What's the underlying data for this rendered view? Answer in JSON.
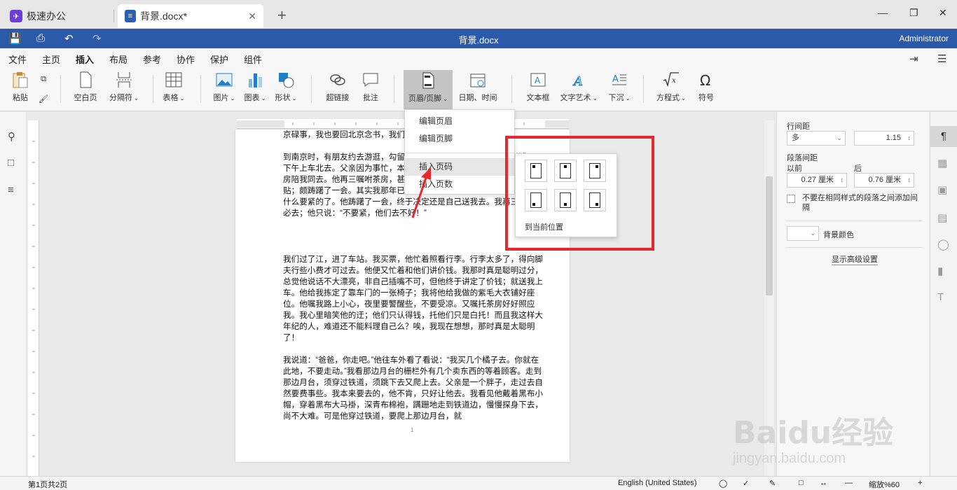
{
  "tabs": [
    {
      "label": "极速办公"
    },
    {
      "label": "背景.docx*"
    }
  ],
  "titlebar": {
    "title": "背景.docx",
    "user": "Administrator"
  },
  "menus": [
    "文件",
    "主页",
    "插入",
    "布局",
    "参考",
    "协作",
    "保护",
    "组件"
  ],
  "ribbon": {
    "paste": "粘贴",
    "blank_page": "空白页",
    "break": "分隔符",
    "table": "表格",
    "image": "图片",
    "chart": "图表",
    "shape": "形状",
    "hyperlink": "超链接",
    "comment": "批注",
    "header_footer": "页眉/页脚",
    "datetime": "日期、时间",
    "textbox": "文本框",
    "wordart": "文字艺术",
    "dropcap": "下沉",
    "equation": "方程式",
    "symbol": "符号"
  },
  "dropdown": {
    "items": [
      "编辑页眉",
      "编辑页脚",
      "插入页码",
      "插入页数"
    ],
    "submenu_label": "到当前位置"
  },
  "document": {
    "line0": "京碌事，我也要回北京念书，我们",
    "p1": "到南京时，有朋友约去游逛，勾留了一日；第二日上午便须渡江到浦口，下午上车北去。父亲因为事忙，本已说定不送我，叫旅馆里一个熟识的茶房陪我同去。他再三嘱咐茶房，甚是仔细。但他终于不放心，怕茶房不妥贴；颇踌躇了一会。其实我那年已二十岁，北京已来往过两三次，是没有什么要紧的了。他踌躇了一会，终于决定还是自己送我去。我再三劝他不必去；他只说：“不要紧，他们去不好！”",
    "p2": "我们过了江，进了车站。我买票，他忙着照看行李。行李太多了，得向脚夫行些小费才可过去。他便又忙着和他们讲价钱。我那时真是聪明过分，总觉他说话不大漂亮，非自己插嘴不可，但他终于讲定了价钱；就送我上车。他给我拣定了靠车门的一张椅子；我将他给我做的紫毛大衣铺好座位。他嘱我路上小心，夜里要警醒些，不要受凉。又嘱托茶房好好照应我。我心里暗笑他的迂；他们只认得钱，托他们只是白托！而且我这样大年纪的人，难道还不能料理自己么？唉，我现在想想，那时真是太聪明了！",
    "p3": "我说道：“爸爸，你走吧。”他往车外看了看说：“我买几个橘子去。你就在此地，不要走动。”我看那边月台的栅栏外有几个卖东西的等着顾客。走到那边月台，须穿过铁道，须跳下去又爬上去。父亲是一个胖子，走过去自然要费事些。我本来要去的，他不肯，只好让他去。我看见他戴着黑布小帽，穿着黑布大马褂，深青布棉袍，蹒跚地走到铁道边，慢慢探身下去，尚不大难。可是他穿过铁道，要爬上那边月台，就",
    "page_number": "1"
  },
  "rpanel": {
    "line_spacing_label": "行间距",
    "line_spacing_mode": "多",
    "line_spacing_value": "1.15",
    "para_spacing_label": "段落间距",
    "before_label": "以前",
    "after_label": "后",
    "before_value": "0.27 厘米",
    "after_value": "0.76 厘米",
    "no_space_same_style": "不要在相同样式的段落之间添加间隔",
    "bg_color_label": "背景颜色",
    "advanced_link": "显示高级设置"
  },
  "statusbar": {
    "page_info": "第1页共2页",
    "language": "English (United States)",
    "zoom": "缩放%60"
  },
  "watermark": {
    "brand": "Baidu经验",
    "url": "jingyan.baidu.com"
  }
}
